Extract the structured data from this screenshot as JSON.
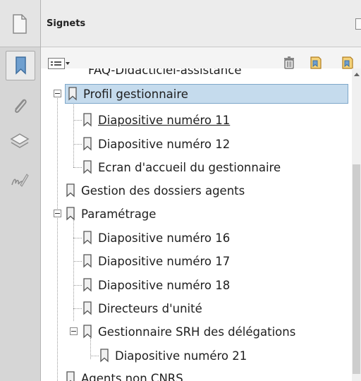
{
  "panel": {
    "title": "Signets"
  },
  "rail": {
    "buttons": [
      {
        "icon": "page-thumbnails-icon"
      },
      {
        "icon": "bookmarks-icon"
      },
      {
        "icon": "attachments-icon"
      },
      {
        "icon": "layers-icon"
      },
      {
        "icon": "signatures-icon"
      }
    ]
  },
  "toolbar": {
    "options_icon": "options-menu-icon",
    "buttons": [
      {
        "icon": "delete-bookmark-icon"
      },
      {
        "icon": "new-bookmark-icon"
      },
      {
        "icon": "expand-bookmark-icon"
      }
    ]
  },
  "bookmarks": [
    {
      "label": "FAQ-Didacticiel-assistance",
      "state": "partially-hidden"
    },
    {
      "label": "Profil gestionnaire",
      "state": "selected",
      "expanded": true
    },
    {
      "label": "Diapositive numéro 11",
      "state": "hover-underlined"
    },
    {
      "label": "Diapositive numéro 12"
    },
    {
      "label": "Ecran d'accueil du gestionnaire"
    },
    {
      "label": "Gestion des dossiers agents"
    },
    {
      "label": "Paramétrage",
      "expanded": true
    },
    {
      "label": "Diapositive numéro 16"
    },
    {
      "label": "Diapositive numéro 17"
    },
    {
      "label": "Diapositive numéro 18"
    },
    {
      "label": "Directeurs d'unité"
    },
    {
      "label": "Gestionnaire SRH des délégations",
      "expanded": true
    },
    {
      "label": "Diapositive numéro 21"
    },
    {
      "label": "Agents non CNRS",
      "state": "partially-hidden"
    }
  ],
  "colors": {
    "selection_fill": "#c5dbed",
    "selection_border": "#7ea7c9",
    "rail_bg": "#d6d6d6"
  }
}
